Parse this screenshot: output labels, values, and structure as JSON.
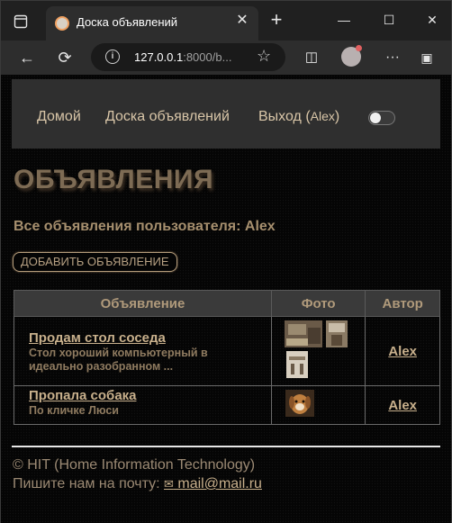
{
  "browser": {
    "tab_title": "Доска объявлений",
    "url_host": "127.0.0.1",
    "url_rest": ":8000/b..."
  },
  "site": {
    "nav": {
      "home": "Домой",
      "board": "Доска объявлений",
      "logout": "Выход (",
      "logout_user": "Alex",
      "logout_close": ")"
    },
    "page_title": "ОБЪЯВЛЕНИЯ",
    "subtitle": "Все объявления пользователя: Alex",
    "add_button": "ДОБАВИТЬ ОБЪЯВЛЕНИЕ",
    "table": {
      "headers": [
        "Объявление",
        "Фото",
        "Автор"
      ],
      "rows": [
        {
          "title": "Продам стол соседа",
          "description": "Стол хороший компьютерный в идеально разобранном ...",
          "author": "Alex"
        },
        {
          "title": "Пропала собака",
          "description": "По кличке Люси",
          "author": "Alex"
        }
      ]
    },
    "footer": {
      "copyright": "© HIT (Home Information Technology)",
      "mail_prefix": "Пишите нам на почту: ",
      "mail": " mail@mail.ru"
    }
  },
  "colors": {
    "accent": "#c8b08c",
    "title": "#7d6b54",
    "nav_bg": "#2f2f2f"
  }
}
